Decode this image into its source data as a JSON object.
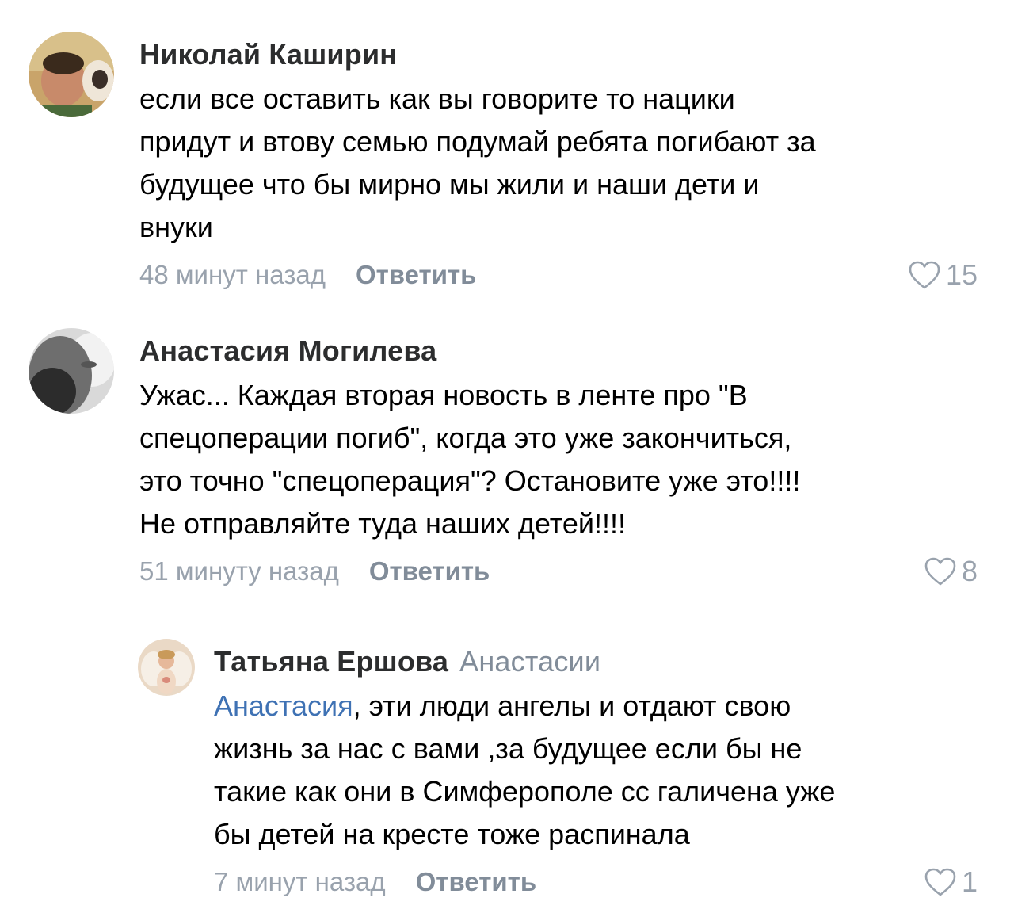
{
  "comments": [
    {
      "author": "Николай Каширин",
      "lines": [
        "если все оставить как вы говорите то нацики",
        "придут и втову семью подумай ребята погибают за",
        "будущее что бы мирно мы жили и наши дети и",
        "внуки"
      ],
      "time": "48 минут назад",
      "reply_label": "Ответить",
      "likes": "15",
      "icon": "heart-outline-icon"
    },
    {
      "author": "Анастасия Могилева",
      "lines": [
        "Ужас... Каждая вторая новость в ленте про \"В",
        "спецоперации погиб\", когда это уже закончиться,",
        "это точно \"спецоперация\"? Остановите уже это!!!!",
        "Не отправляйте туда наших детей!!!!"
      ],
      "time": "51 минуту назад",
      "reply_label": "Ответить",
      "likes": "8",
      "icon": "heart-outline-icon"
    },
    {
      "author": "Татьяна Ершова",
      "reply_to": "Анастасии",
      "mention": "Анастасия",
      "first_line_rest": ", эти люди ангелы и отдают свою",
      "lines": [
        "жизнь за нас с вами ,за будущее если бы не",
        "такие как они в Симферополе сс галичена уже",
        "бы детей на кресте тоже распинала"
      ],
      "time": "7 минут назад",
      "reply_label": "Ответить",
      "likes": "1",
      "icon": "heart-outline-icon"
    }
  ],
  "colors": {
    "author": "#2c2d2e",
    "meta": "#99a2ad",
    "reply_button": "#818c99",
    "mention": "#3f72b4"
  }
}
